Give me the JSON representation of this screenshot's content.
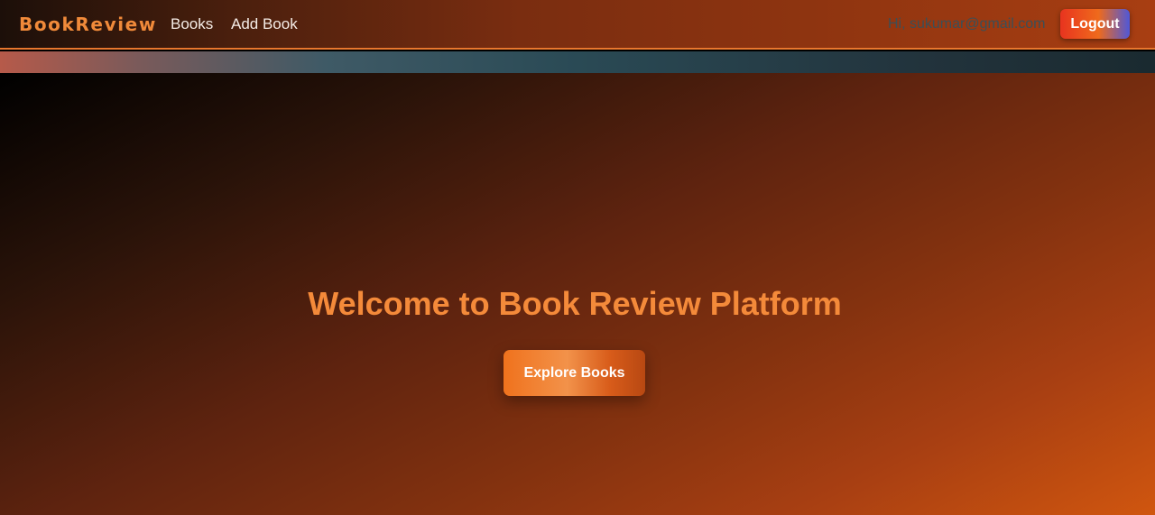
{
  "navbar": {
    "brand": "BookReview",
    "links": [
      {
        "label": "Books"
      },
      {
        "label": "Add Book"
      }
    ],
    "greeting": "Hi, sukumar@gmail.com",
    "logout_label": "Logout"
  },
  "hero": {
    "title": "Welcome to Book Review Platform",
    "cta_label": "Explore Books"
  },
  "colors": {
    "accent": "#f48a3a",
    "navbar_border": "#e8772e",
    "logout_gradient": [
      "#e8341f",
      "#ef6a1c",
      "#4f58d8"
    ],
    "hero_gradient_end": "#d0560f"
  }
}
